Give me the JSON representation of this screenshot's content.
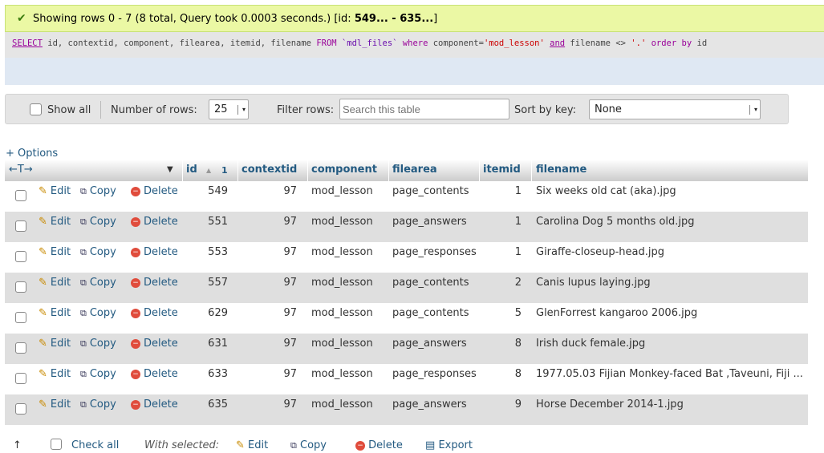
{
  "success": {
    "prefix": "Showing rows 0 - 7 (8 total, Query took 0.0003 seconds.) [id: ",
    "range": "549... - 635...",
    "suffix": "]"
  },
  "sql": {
    "select": "SELECT",
    "cols": " id, contextid, component, filearea, itemid, filename ",
    "from": "FROM",
    "table": " `mdl_files` ",
    "where": "where",
    "cond1": " component=",
    "val1": "'mod_lesson'",
    "and": "and",
    "cond2": " filename <> ",
    "val2": "'.'",
    "order": " order by",
    "orderby": " id"
  },
  "nav": {
    "show_all": "Show all",
    "num_rows_label": "Number of rows:",
    "num_rows_value": "25",
    "filter_label": "Filter rows:",
    "filter_placeholder": "Search this table",
    "sort_label": "Sort by key:",
    "sort_value": "None"
  },
  "options_link": "+ Options",
  "table": {
    "arrows": "←T→",
    "headers": {
      "id": "id",
      "sort_indicator": "1",
      "contextid": "contextid",
      "component": "component",
      "filearea": "filearea",
      "itemid": "itemid",
      "filename": "filename"
    },
    "actions": {
      "edit": "Edit",
      "copy": "Copy",
      "delete": "Delete"
    },
    "rows": [
      {
        "id": "549",
        "contextid": "97",
        "component": "mod_lesson",
        "filearea": "page_contents",
        "itemid": "1",
        "filename": "Six weeks old cat (aka).jpg"
      },
      {
        "id": "551",
        "contextid": "97",
        "component": "mod_lesson",
        "filearea": "page_answers",
        "itemid": "1",
        "filename": "Carolina Dog 5 months old.jpg"
      },
      {
        "id": "553",
        "contextid": "97",
        "component": "mod_lesson",
        "filearea": "page_responses",
        "itemid": "1",
        "filename": "Giraffe-closeup-head.jpg"
      },
      {
        "id": "557",
        "contextid": "97",
        "component": "mod_lesson",
        "filearea": "page_contents",
        "itemid": "2",
        "filename": "Canis lupus laying.jpg"
      },
      {
        "id": "629",
        "contextid": "97",
        "component": "mod_lesson",
        "filearea": "page_contents",
        "itemid": "5",
        "filename": "GlenForrest kangaroo 2006.jpg"
      },
      {
        "id": "631",
        "contextid": "97",
        "component": "mod_lesson",
        "filearea": "page_answers",
        "itemid": "8",
        "filename": "Irish duck female.jpg"
      },
      {
        "id": "633",
        "contextid": "97",
        "component": "mod_lesson",
        "filearea": "page_responses",
        "itemid": "8",
        "filename": "1977.05.03 Fijian Monkey-faced Bat ,Taveuni, Fiji ..."
      },
      {
        "id": "635",
        "contextid": "97",
        "component": "mod_lesson",
        "filearea": "page_answers",
        "itemid": "9",
        "filename": "Horse December 2014-1.jpg"
      }
    ]
  },
  "bottom": {
    "check_all": "Check all",
    "with_selected": "With selected:",
    "edit": "Edit",
    "copy": "Copy",
    "delete": "Delete",
    "export": "Export"
  }
}
